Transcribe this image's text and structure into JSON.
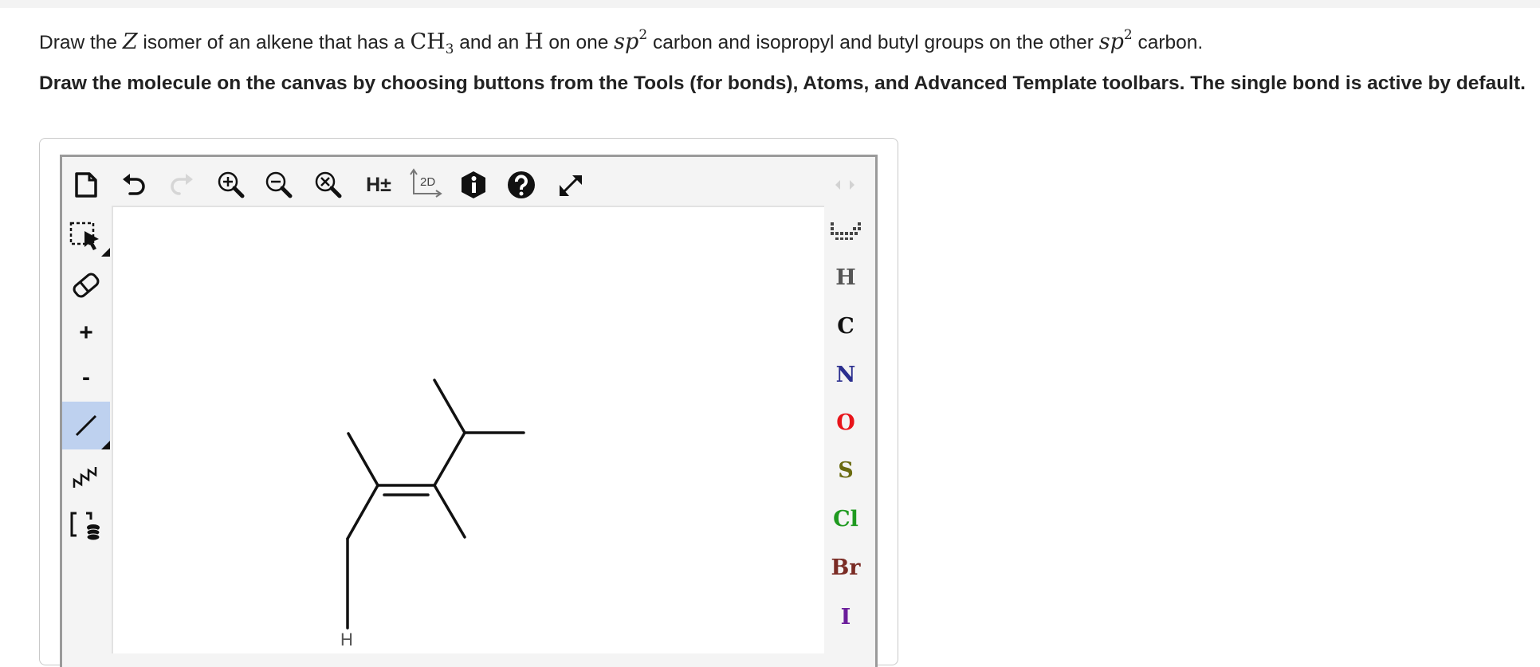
{
  "question": {
    "p1": "Draw the ",
    "z": "Z",
    "p2": " isomer of an alkene that has a ",
    "ch": "CH",
    "ch_sub": "3",
    "p3": " and an ",
    "h": "H",
    "p4": " on one ",
    "sp": "sp",
    "sp_sup": "2",
    "p5": " carbon and isopropyl and butyl groups on the other ",
    "sp2": "sp",
    "sp2_sup": "2",
    "p6": " carbon."
  },
  "instructions": "Draw the molecule on the canvas by choosing buttons from the Tools (for bonds), Atoms, and Advanced Template toolbars. The single bond is active by default.",
  "toolbar": {
    "top": [
      "new-document-icon",
      "undo-icon",
      "redo-icon",
      "zoom-in-icon",
      "zoom-out-icon",
      "zoom-reset-icon",
      "hydrogens-toggle",
      "clean-2d-icon",
      "info-icon",
      "help-icon",
      "fullscreen-icon"
    ],
    "hydrogens_label": "H±",
    "clean2d_label": "2D",
    "charge_plus": "+",
    "charge_minus": "-",
    "active_tool": "single-bond",
    "active_color": "#bed1ef"
  },
  "atoms": {
    "items": [
      {
        "label": "H",
        "color": "#555555"
      },
      {
        "label": "C",
        "color": "#111111"
      },
      {
        "label": "N",
        "color": "#2b2f8f"
      },
      {
        "label": "O",
        "color": "#e8141a"
      },
      {
        "label": "S",
        "color": "#6b6b10"
      },
      {
        "label": "Cl",
        "color": "#1f9a20"
      },
      {
        "label": "Br",
        "color": "#7a2b24"
      },
      {
        "label": "I",
        "color": "#6a1d9a"
      }
    ]
  },
  "molecule": {
    "atom_labels": [
      "H"
    ]
  }
}
